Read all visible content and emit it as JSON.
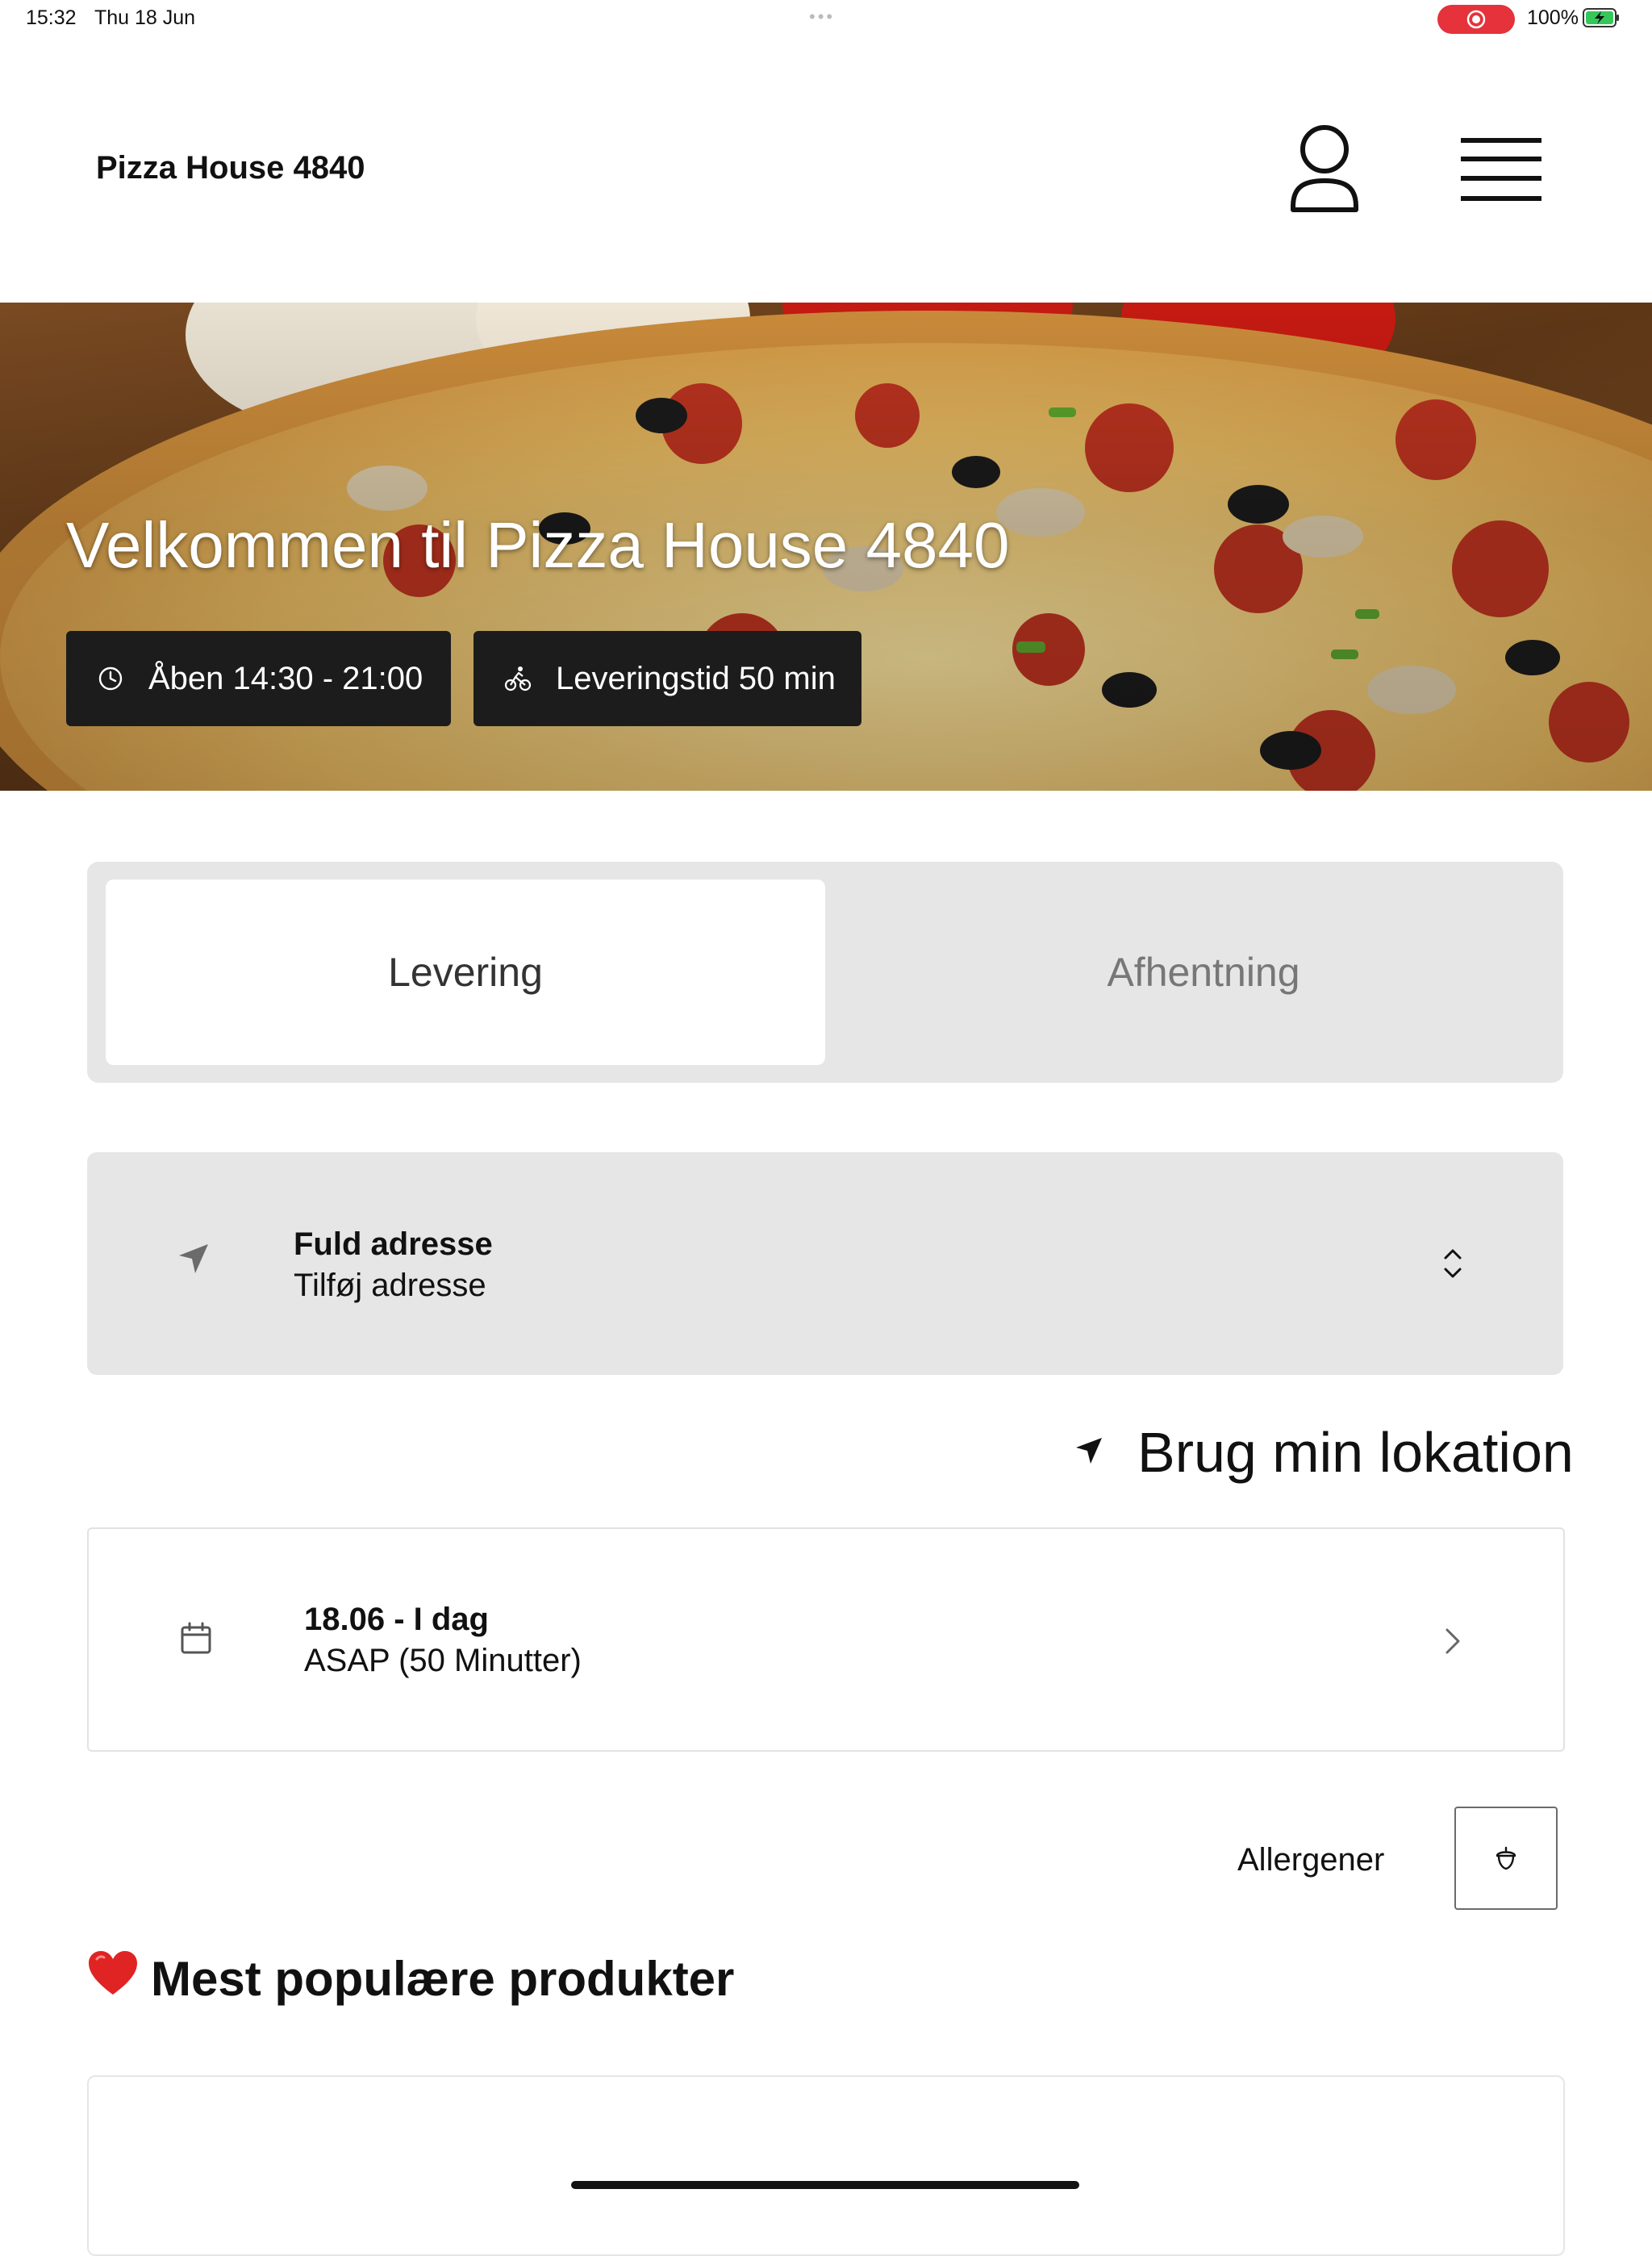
{
  "status_bar": {
    "time": "15:32",
    "date": "Thu 18 Jun",
    "multitask_dots": "•••",
    "battery_percent": "100%",
    "record_color": "#e5323b",
    "battery_charging_color": "#34c759"
  },
  "header": {
    "brand": "Pizza House 4840",
    "user_icon": "user-icon",
    "menu_icon": "hamburger-menu-icon"
  },
  "hero": {
    "title": "Velkommen til Pizza House 4840",
    "open_hours": "Åben 14:30 - 21:00",
    "delivery_time": "Leveringstid 50 min",
    "open_icon": "clock-icon",
    "delivery_icon": "bicycle-icon"
  },
  "order_type": {
    "tabs": [
      "Levering",
      "Afhentning"
    ],
    "selected": "Levering"
  },
  "address": {
    "title": "Fuld adresse",
    "placeholder": "Tilføj adresse",
    "icon": "location-arrow-icon",
    "expand_icon": "chevron-up-down-icon"
  },
  "use_location": {
    "label": "Brug min lokation",
    "icon": "location-arrow-icon"
  },
  "schedule": {
    "date": "18.06 - I dag",
    "time": "ASAP (50 Minutter)",
    "icon": "calendar-icon",
    "chevron": "chevron-right-icon"
  },
  "allergens": {
    "label": "Allergener",
    "icon": "acorn-icon"
  },
  "popular": {
    "title": "Mest populære produkter",
    "emoji_icon": "red-heart-icon"
  }
}
